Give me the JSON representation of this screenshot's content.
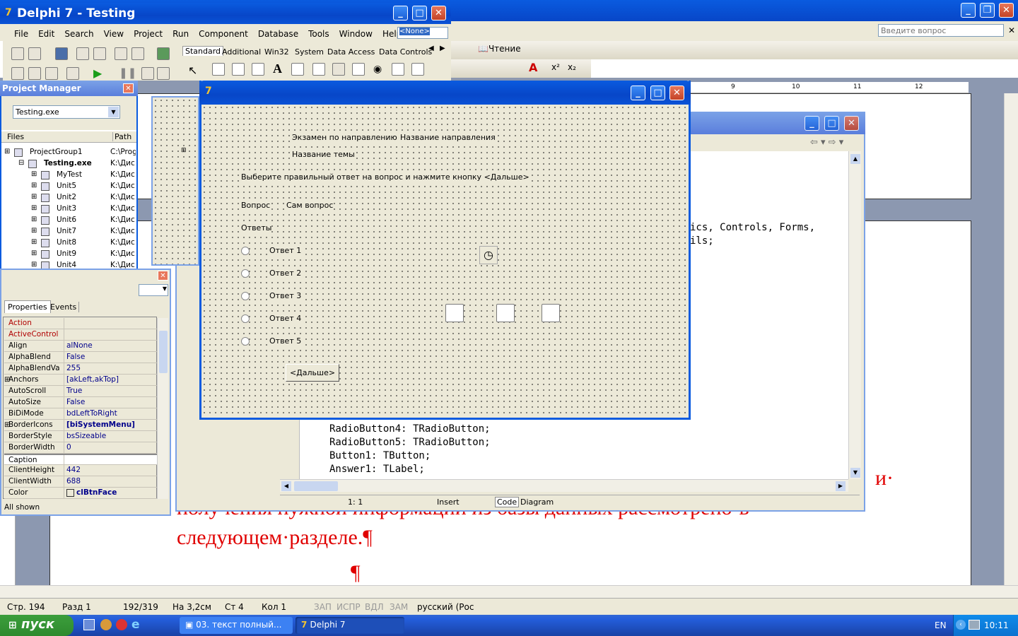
{
  "word": {
    "search_placeholder": "Введите вопрос",
    "reading_button": "Чтение",
    "doc_text_line1_end": "и·",
    "doc_text_line2": "получения нужной информации из базы данных рассмотрено·в·",
    "doc_text_line3": "следующем·разделе.¶",
    "doc_text_line4": "¶",
    "ruler_marks": [
      "9",
      "10",
      "11",
      "12"
    ],
    "status": {
      "page": "Стр. 194",
      "section": "Разд 1",
      "pages": "192/319",
      "at": "На 3,2см",
      "line": "Ст 4",
      "col": "Кол 1",
      "rec": "ЗАП",
      "trk": "ИСПР",
      "ext": "ВДЛ",
      "ovr": "ЗАМ",
      "lang": "русский (Рос"
    }
  },
  "delphi": {
    "title": "Delphi 7 - Testing",
    "menu": [
      "File",
      "Edit",
      "Search",
      "View",
      "Project",
      "Run",
      "Component",
      "Database",
      "Tools",
      "Window",
      "Help"
    ],
    "combo_value": "<None>",
    "palette_tabs": [
      "Standard",
      "Additional",
      "Win32",
      "System",
      "Data Access",
      "Data Controls"
    ]
  },
  "project_manager": {
    "title": "Project Manager",
    "combo": "Testing.exe",
    "col_files": "Files",
    "col_path": "Path",
    "items": [
      {
        "name": "ProjectGroup1",
        "path": "C:\\Prog",
        "bold": false,
        "indent": 0
      },
      {
        "name": "Testing.exe",
        "path": "K:\\Дис",
        "bold": true,
        "indent": 1
      },
      {
        "name": "MyTest",
        "path": "K:\\Дис",
        "bold": false,
        "indent": 2
      },
      {
        "name": "Unit5",
        "path": "K:\\Дис",
        "bold": false,
        "indent": 2
      },
      {
        "name": "Unit2",
        "path": "K:\\Дис",
        "bold": false,
        "indent": 2
      },
      {
        "name": "Unit3",
        "path": "K:\\Дис",
        "bold": false,
        "indent": 2
      },
      {
        "name": "Unit6",
        "path": "K:\\Дис",
        "bold": false,
        "indent": 2
      },
      {
        "name": "Unit7",
        "path": "K:\\Дис",
        "bold": false,
        "indent": 2
      },
      {
        "name": "Unit8",
        "path": "K:\\Дис",
        "bold": false,
        "indent": 2
      },
      {
        "name": "Unit9",
        "path": "K:\\Дис",
        "bold": false,
        "indent": 2
      },
      {
        "name": "Unit4",
        "path": "K:\\Дис",
        "bold": false,
        "indent": 2
      }
    ]
  },
  "inspector": {
    "tab_properties": "Properties",
    "tab_events": "Events",
    "footer": "All shown",
    "rows": [
      {
        "k": "Action",
        "v": "",
        "red": true
      },
      {
        "k": "ActiveControl",
        "v": "",
        "red": true
      },
      {
        "k": "Align",
        "v": "alNone"
      },
      {
        "k": "AlphaBlend",
        "v": "False"
      },
      {
        "k": "AlphaBlendValu",
        "v": "255"
      },
      {
        "k": "Anchors",
        "v": "[akLeft,akTop]",
        "plus": true
      },
      {
        "k": "AutoScroll",
        "v": "True"
      },
      {
        "k": "AutoSize",
        "v": "False"
      },
      {
        "k": "BiDiMode",
        "v": "bdLeftToRight"
      },
      {
        "k": "BorderIcons",
        "v": "[biSystemMenu]",
        "plus": true,
        "bold": true
      },
      {
        "k": "BorderStyle",
        "v": "bsSizeable"
      },
      {
        "k": "BorderWidth",
        "v": "0"
      },
      {
        "k": "Caption",
        "v": "",
        "selected": true
      },
      {
        "k": "ClientHeight",
        "v": "442"
      },
      {
        "k": "ClientWidth",
        "v": "688"
      },
      {
        "k": "Color",
        "v": "clBtnFace",
        "bold": true
      }
    ]
  },
  "form": {
    "label_exam": "Экзамен по направлению",
    "label_direction": "Название направления",
    "label_topic": "Название темы",
    "label_instruction": "Выберите правильный ответ на вопрос  и нажмите кнопку <Дальше>",
    "label_question": "Вопрос",
    "label_question_text": "Сам вопрос",
    "label_answers": "Ответы",
    "answers": [
      "Ответ 1",
      "Ответ 2",
      "Ответ 3",
      "Ответ 4",
      "Ответ 5"
    ],
    "next_button": "<Дальше>"
  },
  "editor": {
    "code_top1": "ics, Controls, Forms,",
    "code_top2": "ils;",
    "code_lines": [
      "RadioButton4: TRadioButton;",
      "RadioButton5: TRadioButton;",
      "Button1: TButton;",
      "Answer1: TLabel;"
    ],
    "pos": "1:   1",
    "mode": "Insert",
    "tab_code": "Code",
    "tab_diagram": "Diagram"
  },
  "taskbar": {
    "start": "пуск",
    "task1": "03. текст полный...",
    "task2": "Delphi 7",
    "lang": "EN",
    "clock": "10:11"
  }
}
